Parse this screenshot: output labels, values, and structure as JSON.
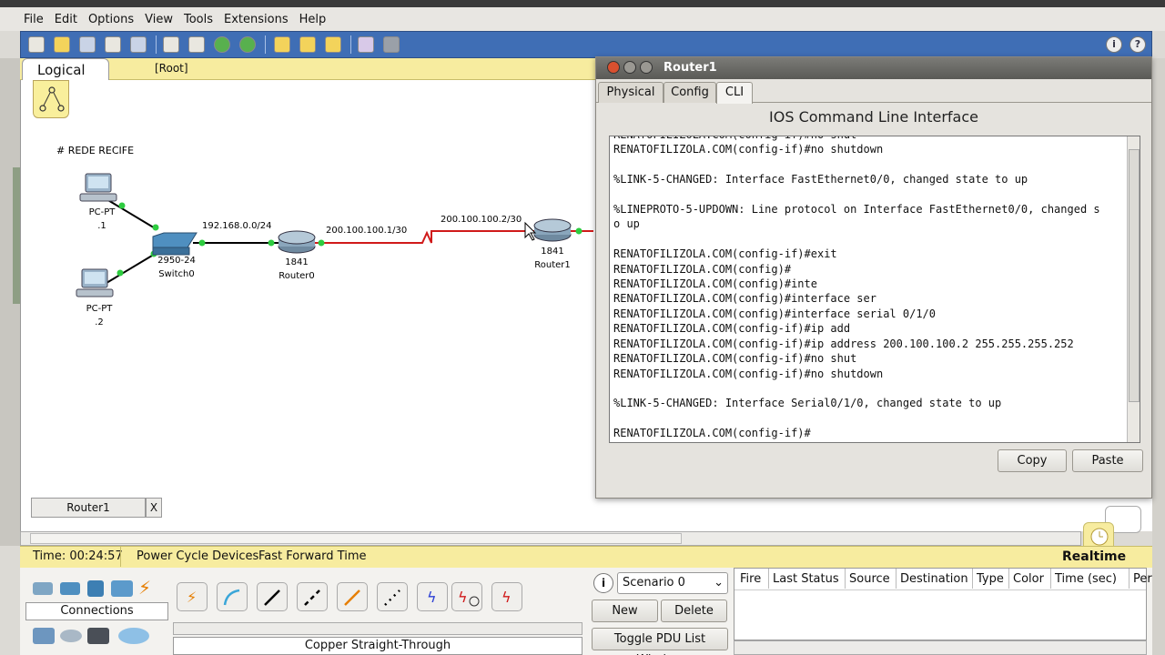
{
  "menu": [
    "File",
    "Edit",
    "Options",
    "View",
    "Tools",
    "Extensions",
    "Help"
  ],
  "workspace": {
    "tab_label": "Logical",
    "root_label": "[Root]",
    "network_label": "# REDE RECIFE",
    "pc1_model": "PC-PT",
    "pc1_name": ".1",
    "pc2_model": "PC-PT",
    "pc2_name": ".2",
    "switch_model": "2950-24",
    "switch_name": "Switch0",
    "router0_model": "1841",
    "router0_name": "Router0",
    "router1_model": "1841",
    "router1_name": "Router1",
    "lan_subnet": "192.168.0.0/24",
    "serial_r0": "200.100.100.1/30",
    "serial_r1": "200.100.100.2/30",
    "open_tab": "Router1",
    "open_tab_close": "X"
  },
  "router_window": {
    "title": "Router1",
    "tabs": [
      "Physical",
      "Config",
      "CLI"
    ],
    "active_tab": "CLI",
    "heading": "IOS Command Line Interface",
    "cli_lines": [
      "RENATOFILIZOLA.COM(config-if)#no shut",
      "RENATOFILIZOLA.COM(config-if)#no shutdown",
      "",
      "%LINK-5-CHANGED: Interface FastEthernet0/0, changed state to up",
      "",
      "%LINEPROTO-5-UPDOWN: Line protocol on Interface FastEthernet0/0, changed s",
      "o up",
      "",
      "RENATOFILIZOLA.COM(config-if)#exit",
      "RENATOFILIZOLA.COM(config)#",
      "RENATOFILIZOLA.COM(config)#inte",
      "RENATOFILIZOLA.COM(config)#interface ser",
      "RENATOFILIZOLA.COM(config)#interface serial 0/1/0",
      "RENATOFILIZOLA.COM(config-if)#ip add",
      "RENATOFILIZOLA.COM(config-if)#ip address 200.100.100.2 255.255.255.252",
      "RENATOFILIZOLA.COM(config-if)#no shut",
      "RENATOFILIZOLA.COM(config-if)#no shutdown",
      "",
      "%LINK-5-CHANGED: Interface Serial0/1/0, changed state to up",
      "",
      "RENATOFILIZOLA.COM(config-if)#"
    ],
    "copy_label": "Copy",
    "paste_label": "Paste"
  },
  "status": {
    "time": "Time: 00:24:57",
    "power_cycle": "Power Cycle Devices",
    "fast_forward": "Fast Forward Time",
    "mode": "Realtime"
  },
  "bottom": {
    "category_label": "Connections",
    "cable_name": "Copper Straight-Through",
    "scenario": "Scenario 0",
    "new_label": "New",
    "delete_label": "Delete",
    "toggle_label": "Toggle PDU List Window",
    "info_label": "i",
    "pdu_columns": [
      "Fire",
      "Last Status",
      "Source",
      "Destination",
      "Type",
      "Color",
      "Time (sec)",
      "Per"
    ]
  },
  "colors": {
    "toolbar": "#3f6eb5",
    "yellow_bar": "#f7ec9f",
    "serial_link": "#d01a1a",
    "link_up": "#2ecc40"
  }
}
